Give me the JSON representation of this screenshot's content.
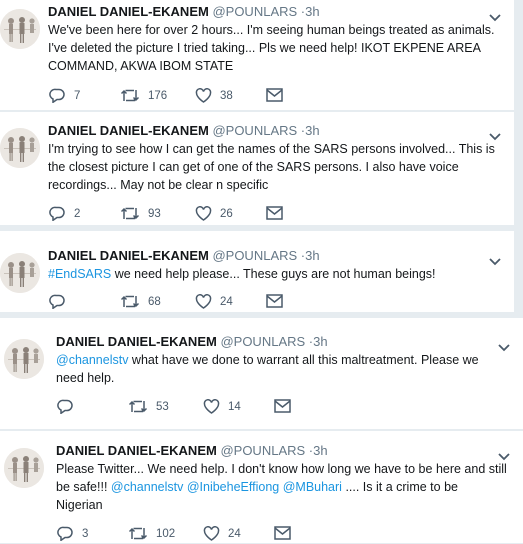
{
  "tweets": [
    {
      "name": "DANIEL DANIEL-EKANEM",
      "handle": "@POUNLARS",
      "time": "3h",
      "lines": [
        [
          {
            "t": "We've been here for over 2 hours... I'm seeing human beings treated as animals."
          }
        ],
        [
          {
            "t": "I've deleted the picture I tried taking... Pls we need help! IKOT EKPENE AREA"
          }
        ],
        [
          {
            "t": "COMMAND, AKWA IBOM STATE"
          }
        ]
      ],
      "replies": "7",
      "retweets": "176",
      "likes": "38"
    },
    {
      "name": "DANIEL DANIEL-EKANEM",
      "handle": "@POUNLARS",
      "time": "3h",
      "lines": [
        [
          {
            "t": "I'm trying to see how I can get the names of the SARS persons involved... This is"
          }
        ],
        [
          {
            "t": "the closest picture I can get of one of the SARS persons. I also have voice"
          }
        ],
        [
          {
            "t": "recordings... May not be clear n specific"
          }
        ]
      ],
      "replies": "2",
      "retweets": "93",
      "likes": "26"
    },
    {
      "name": "DANIEL DANIEL-EKANEM",
      "handle": "@POUNLARS",
      "time": "3h",
      "lines": [
        [
          {
            "t": "#EndSARS",
            "link": true
          },
          {
            "t": " we need help please... These guys are not human beings!"
          }
        ]
      ],
      "replies": "",
      "retweets": "68",
      "likes": "24"
    },
    {
      "name": "DANIEL DANIEL-EKANEM",
      "handle": "@POUNLARS",
      "time": "3h",
      "lines": [
        [
          {
            "t": "@channelstv",
            "link": true
          },
          {
            "t": " what have we done to warrant all this maltreatment. Please we"
          }
        ],
        [
          {
            "t": "need help."
          }
        ]
      ],
      "replies": "",
      "retweets": "53",
      "likes": "14"
    },
    {
      "name": "DANIEL DANIEL-EKANEM",
      "handle": "@POUNLARS",
      "time": "3h",
      "lines": [
        [
          {
            "t": "Please Twitter... We need help. I don't know how long we have to be here and still"
          }
        ],
        [
          {
            "t": "be safe!!! "
          },
          {
            "t": "@channelstv",
            "link": true
          },
          {
            "t": " "
          },
          {
            "t": "@InibeheEffiong",
            "link": true
          },
          {
            "t": " "
          },
          {
            "t": "@MBuhari",
            "link": true
          },
          {
            "t": " .... Is it a crime to be"
          }
        ],
        [
          {
            "t": "Nigerian"
          }
        ]
      ],
      "replies": "3",
      "retweets": "102",
      "likes": "24"
    }
  ],
  "separator": "·",
  "icons": {
    "reply": "reply-icon",
    "retweet": "retweet-icon",
    "like": "heart-icon",
    "message": "envelope-icon",
    "more": "chevron-down-icon"
  },
  "colors": {
    "text": "#14171a",
    "secondary": "#657786",
    "link": "#1b95e0",
    "border": "#e6ecf0"
  }
}
